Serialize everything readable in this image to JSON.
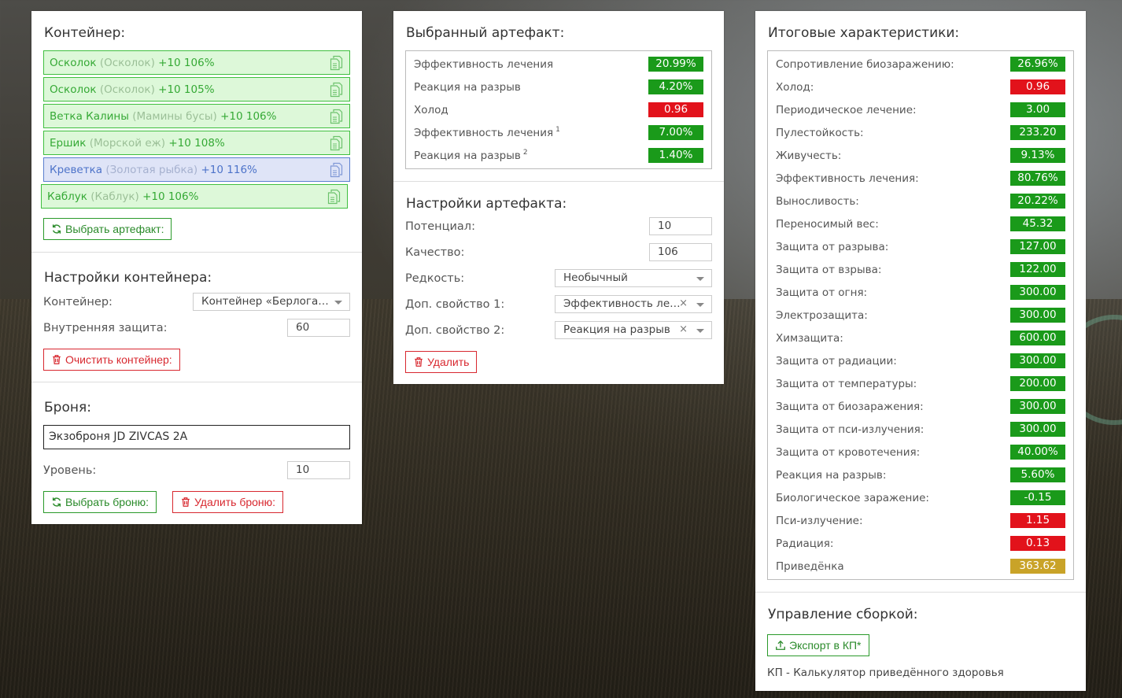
{
  "container_panel": {
    "title": "Контейнер:",
    "items": [
      {
        "name": "Осколок",
        "sub": "(Осколок)",
        "suffix": "+10 106%"
      },
      {
        "name": "Осколок",
        "sub": "(Осколок)",
        "suffix": "+10 105%"
      },
      {
        "name": "Ветка Калины",
        "sub": "(Мамины бусы)",
        "suffix": "+10 106%"
      },
      {
        "name": "Ершик",
        "sub": "(Морской еж)",
        "suffix": "+10 108%"
      },
      {
        "name": "Креветка",
        "sub": "(Золотая рыбка)",
        "suffix": "+10 116%"
      },
      {
        "name": "Каблук",
        "sub": "(Каблук)",
        "suffix": "+10 106%"
      }
    ],
    "select_artifact_button": "Выбрать артефакт:",
    "settings_title": "Настройки контейнера:",
    "container_label": "Контейнер:",
    "container_value": "Контейнер «Берлога…",
    "inner_protection_label": "Внутренняя защита:",
    "inner_protection_value": "60",
    "clear_button": "Очистить контейнер:",
    "armor_title": "Броня:",
    "armor_name": "Экзоброня JD ZIVCAS 2A",
    "level_label": "Уровень:",
    "level_value": "10",
    "select_armor_button": "Выбрать броню:",
    "delete_armor_button": "Удалить броню:"
  },
  "artifact_panel": {
    "title": "Выбранный артефакт:",
    "stats": [
      {
        "label": "Эффективность лечения",
        "sup": "",
        "value": "20.99%",
        "color": "#1a9a1a"
      },
      {
        "label": "Реакция на разрыв",
        "sup": "",
        "value": "4.20%",
        "color": "#1a9a1a"
      },
      {
        "label": "Холод",
        "sup": "",
        "value": "0.96",
        "color": "#e2121b"
      },
      {
        "label": "Эффективность лечения",
        "sup": "1",
        "value": "7.00%",
        "color": "#1a9a1a"
      },
      {
        "label": "Реакция на разрыв",
        "sup": "2",
        "value": "1.40%",
        "color": "#1a9a1a"
      }
    ],
    "settings_title": "Настройки артефакта:",
    "potential_label": "Потенциал:",
    "potential_value": "10",
    "quality_label": "Качество:",
    "quality_value": "106",
    "rarity_label": "Редкость:",
    "rarity_value": "Необычный",
    "prop1_label": "Доп. свойство 1:",
    "prop1_value": "Эффективность ле…",
    "prop2_label": "Доп. свойство 2:",
    "prop2_value": "Реакция на разрыв",
    "delete_button": "Удалить"
  },
  "totals_panel": {
    "title": "Итоговые характеристики:",
    "stats": [
      {
        "label": "Сопротивление биозаражению:",
        "value": "26.96%",
        "color": "#1a9a1a"
      },
      {
        "label": "Холод:",
        "value": "0.96",
        "color": "#e2121b"
      },
      {
        "label": "Периодическое лечение:",
        "value": "3.00",
        "color": "#1a9a1a"
      },
      {
        "label": "Пулестойкость:",
        "value": "233.20",
        "color": "#1a9a1a"
      },
      {
        "label": "Живучесть:",
        "value": "9.13%",
        "color": "#1a9a1a"
      },
      {
        "label": "Эффективность лечения:",
        "value": "80.76%",
        "color": "#1a9a1a"
      },
      {
        "label": "Выносливость:",
        "value": "20.22%",
        "color": "#1a9a1a"
      },
      {
        "label": "Переносимый вес:",
        "value": "45.32",
        "color": "#1a9a1a"
      },
      {
        "label": "Защита от разрыва:",
        "value": "127.00",
        "color": "#1a9a1a"
      },
      {
        "label": "Защита от взрыва:",
        "value": "122.00",
        "color": "#1a9a1a"
      },
      {
        "label": "Защита от огня:",
        "value": "300.00",
        "color": "#1a9a1a"
      },
      {
        "label": "Электрозащита:",
        "value": "300.00",
        "color": "#1a9a1a"
      },
      {
        "label": "Химзащита:",
        "value": "600.00",
        "color": "#1a9a1a"
      },
      {
        "label": "Защита от радиации:",
        "value": "300.00",
        "color": "#1a9a1a"
      },
      {
        "label": "Защита от температуры:",
        "value": "200.00",
        "color": "#1a9a1a"
      },
      {
        "label": "Защита от биозаражения:",
        "value": "300.00",
        "color": "#1a9a1a"
      },
      {
        "label": "Защита от пси-излучения:",
        "value": "300.00",
        "color": "#1a9a1a"
      },
      {
        "label": "Защита от кровотечения:",
        "value": "40.00%",
        "color": "#1a9a1a"
      },
      {
        "label": "Реакция на разрыв:",
        "value": "5.60%",
        "color": "#1a9a1a"
      },
      {
        "label": "Биологическое заражение:",
        "value": "-0.15",
        "color": "#1a9a1a"
      },
      {
        "label": "Пси-излучение:",
        "value": "1.15",
        "color": "#e2121b"
      },
      {
        "label": "Радиация:",
        "value": "0.13",
        "color": "#e2121b"
      },
      {
        "label": "Приведёнка",
        "value": "363.62",
        "color": "#c9a328"
      }
    ],
    "build_title": "Управление сборкой:",
    "export_button": "Экспорт в КП*",
    "footnote": "КП - Калькулятор приведённого здоровья"
  }
}
